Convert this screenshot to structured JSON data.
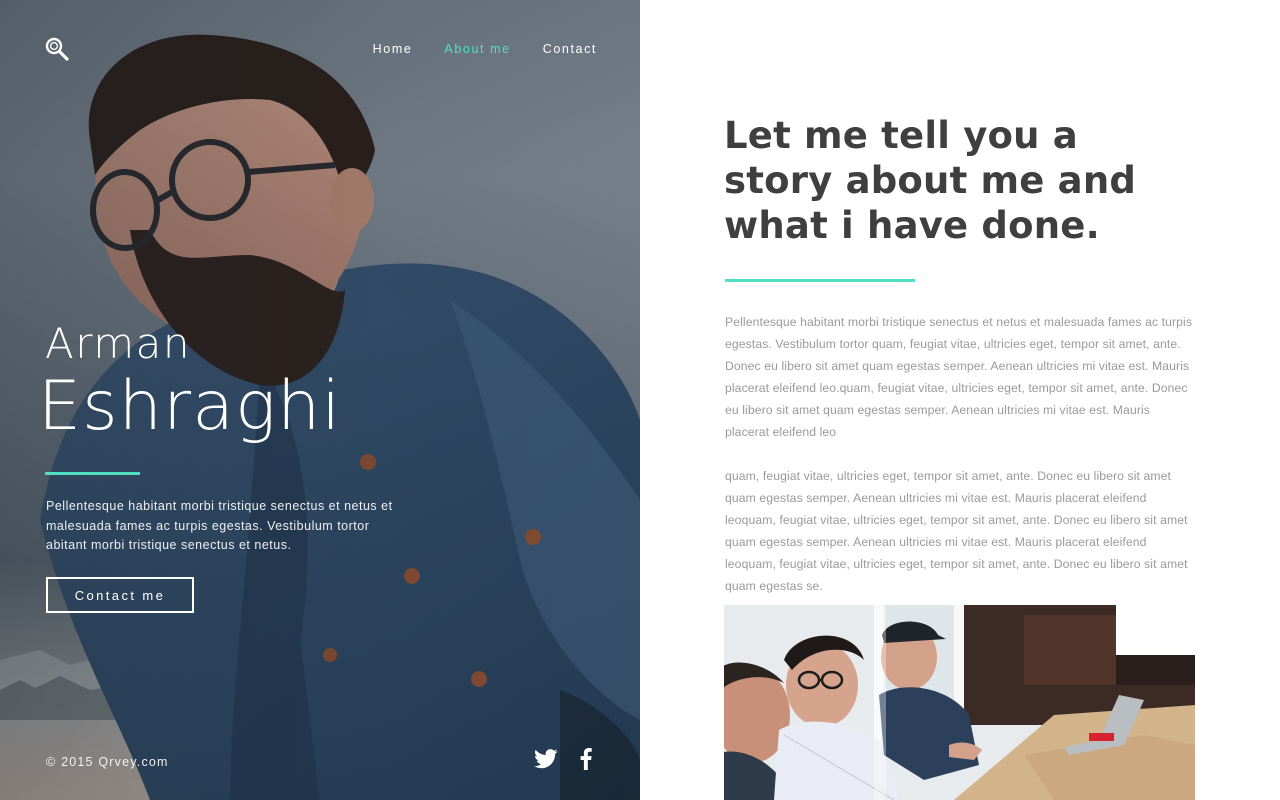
{
  "nav": {
    "items": [
      {
        "label": "Home",
        "active": false
      },
      {
        "label": "About me",
        "active": true
      },
      {
        "label": "Contact",
        "active": false
      }
    ]
  },
  "hero": {
    "first_name": "Arman",
    "last_name": "Eshraghi",
    "description": "Pellentesque habitant morbi tristique senectus et netus et malesuada fames ac turpis egestas. Vestibulum tortor abitant morbi tristique senectus et netus.",
    "contact_label": "Contact me",
    "copyright": "© 2015 Qrvey.com"
  },
  "story": {
    "title": "Let me tell you a story about me and what i have done.",
    "paragraph_1": "Pellentesque habitant morbi tristique senectus et netus et malesuada fames ac turpis egestas. Vestibulum tortor quam, feugiat vitae, ultricies eget, tempor sit amet, ante. Donec eu libero sit amet quam egestas semper. Aenean ultricies mi vitae est. Mauris placerat eleifend leo.quam, feugiat vitae, ultricies eget, tempor sit amet, ante. Donec eu libero sit amet quam egestas semper. Aenean ultricies mi vitae est. Mauris placerat eleifend leo",
    "paragraph_2": "quam, feugiat vitae, ultricies eget, tempor sit amet, ante. Donec eu libero sit amet quam egestas semper. Aenean ultricies mi vitae est. Mauris placerat eleifend leoquam, feugiat vitae, ultricies eget, tempor sit amet, ante. Donec eu libero sit amet quam egestas semper. Aenean ultricies mi vitae est. Mauris placerat eleifend leoquam, feugiat vitae, ultricies eget, tempor sit amet, ante. Donec eu libero sit amet quam egestas se."
  },
  "social": {
    "icons": [
      "twitter-icon",
      "facebook-icon"
    ]
  },
  "colors": {
    "accent": "#4fe0c3",
    "heading": "#3f3f3f",
    "body_text": "#9a9a9a",
    "hero_text": "#ffffff"
  }
}
